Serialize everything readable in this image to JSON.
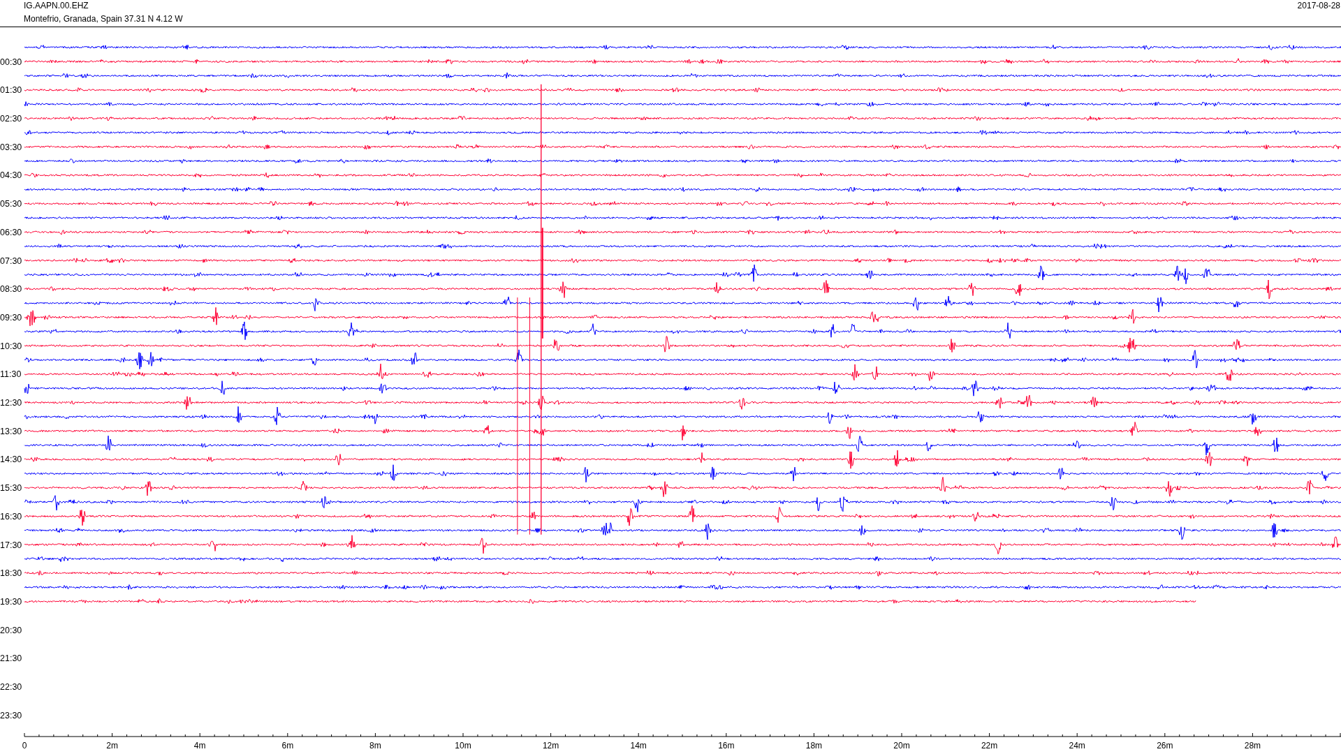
{
  "header": {
    "station": "IG.AAPN.00.EHZ",
    "location": "Montefrio, Granada, Spain  37.31 N 4.12 W",
    "date": "2017-08-28"
  },
  "hour_labels": [
    "00:30",
    "01:30",
    "02:30",
    "03:30",
    "04:30",
    "05:30",
    "06:30",
    "07:30",
    "08:30",
    "09:30",
    "10:30",
    "11:30",
    "12:30",
    "13:30",
    "14:30",
    "15:30",
    "16:30",
    "17:30",
    "18:30",
    "19:30",
    "20:30",
    "21:30",
    "22:30",
    "23:30"
  ],
  "traces": [
    {
      "color": "#0000ff",
      "level": 1
    },
    {
      "color": "#ff0033",
      "level": 1
    },
    {
      "color": "#0000ff",
      "level": 1
    },
    {
      "color": "#ff0033",
      "level": 1
    },
    {
      "color": "#0000ff",
      "level": 1
    },
    {
      "color": "#ff0033",
      "level": 1
    },
    {
      "color": "#0000ff",
      "level": 1
    },
    {
      "color": "#ff0033",
      "level": 1
    },
    {
      "color": "#0000ff",
      "level": 1
    },
    {
      "color": "#ff0033",
      "level": 1
    },
    {
      "color": "#0000ff",
      "level": 1
    },
    {
      "color": "#ff0033",
      "level": 1
    },
    {
      "color": "#0000ff",
      "level": 1
    },
    {
      "color": "#ff0033",
      "level": 1
    },
    {
      "color": "#0000ff",
      "level": 1
    },
    {
      "color": "#ff0033",
      "level": 1
    },
    {
      "color": "#0000ff",
      "level": 1
    },
    {
      "color": "#ff0033",
      "level": 1
    },
    {
      "color": "#0000ff",
      "level": 1
    },
    {
      "color": "#ff0033",
      "level": 1
    },
    {
      "color": "#0000ff",
      "level": 1
    },
    {
      "color": "#ff0033",
      "level": 1
    },
    {
      "color": "#0000ff",
      "level": 1
    },
    {
      "color": "#ff0033",
      "level": 1
    },
    {
      "color": "#0000ff",
      "level": 1
    },
    {
      "color": "#ff0033",
      "level": 1
    },
    {
      "color": "#0000ff",
      "level": 1
    },
    {
      "color": "#ff0033",
      "level": 1
    },
    {
      "color": "#0000ff",
      "level": 1
    },
    {
      "color": "#ff0033",
      "level": 1
    },
    {
      "color": "#0000ff",
      "level": 1
    },
    {
      "color": "#ff0033",
      "level": 1
    },
    {
      "color": "#0000ff",
      "level": 1
    },
    {
      "color": "#ff0033",
      "level": 1
    },
    {
      "color": "#0000ff",
      "level": 1
    },
    {
      "color": "#ff0033",
      "level": 1
    },
    {
      "color": "#0000ff",
      "level": 1
    },
    {
      "color": "#ff0033",
      "level": 1
    },
    {
      "color": "#0000ff",
      "level": 1
    },
    {
      "color": "#ff0033",
      "level": 0.89
    }
  ],
  "time_axis": {
    "labels": [
      "0",
      "2m",
      "4m",
      "6m",
      "8m",
      "10m",
      "12m",
      "14m",
      "16m",
      "18m",
      "20m",
      "22m",
      "24m",
      "26m",
      "28m"
    ]
  }
}
